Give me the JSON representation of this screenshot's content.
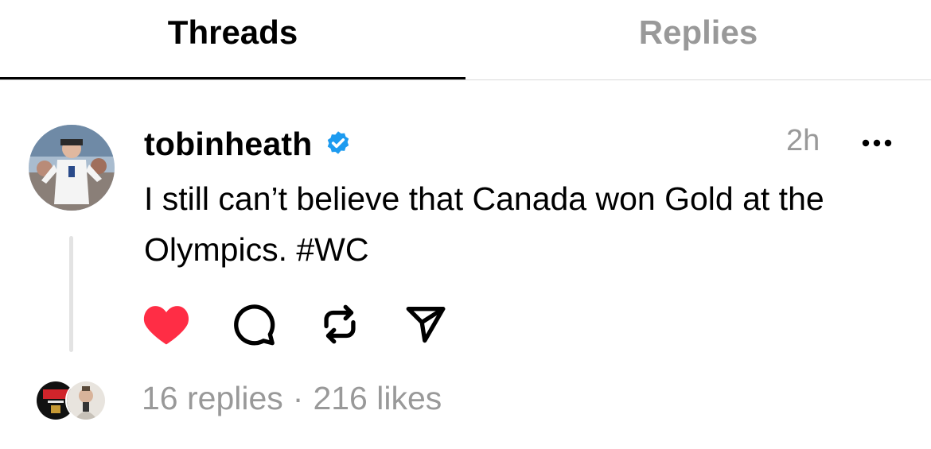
{
  "tabs": {
    "threads_label": "Threads",
    "replies_label": "Replies",
    "active": "Threads"
  },
  "post": {
    "username": "tobinheath",
    "verified": true,
    "timestamp": "2h",
    "text": "I still can’t believe that Canada won Gold at the Olympics. #WC",
    "liked": true,
    "icons": {
      "more": "more-horizontal-icon",
      "like": "heart-filled-icon",
      "reply": "comment-bubble-icon",
      "repost": "repost-icon",
      "share": "send-icon",
      "verified": "verified-badge-icon"
    },
    "colors": {
      "like": "#ff2d45",
      "verified": "#1d9bf0",
      "muted": "#999999"
    }
  },
  "footer": {
    "replies_text": "16 replies",
    "separator": "·",
    "likes_text": "216 likes"
  }
}
